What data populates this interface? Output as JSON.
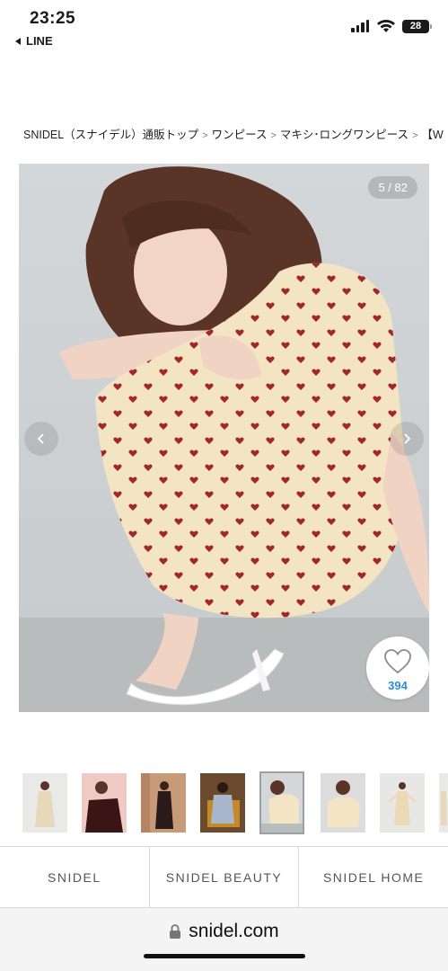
{
  "status_bar": {
    "time": "23:25",
    "back_app": "LINE",
    "battery": "28"
  },
  "breadcrumb": {
    "items": [
      "SNIDEL（スナイデル）通販トップ",
      "ワンピース",
      "マキシ･ロングワンピース",
      "【W"
    ],
    "separator": ">"
  },
  "gallery": {
    "counter": "5 / 82",
    "prev_icon": "chevron-left-icon",
    "next_icon": "chevron-right-icon",
    "like_icon": "heart-outline-icon",
    "like_count": "394",
    "thumbnail_count": 10,
    "active_thumbnail": 5
  },
  "brand_nav": {
    "tabs": [
      "SNIDEL",
      "SNIDEL BEAUTY",
      "SNIDEL HOME"
    ]
  },
  "url_bar": {
    "lock_icon": "lock-icon",
    "url": "snidel.com"
  },
  "colors": {
    "like_count": "#2a8fd9",
    "dress": "#f3e4c3",
    "heart_print": "#a3262a"
  }
}
